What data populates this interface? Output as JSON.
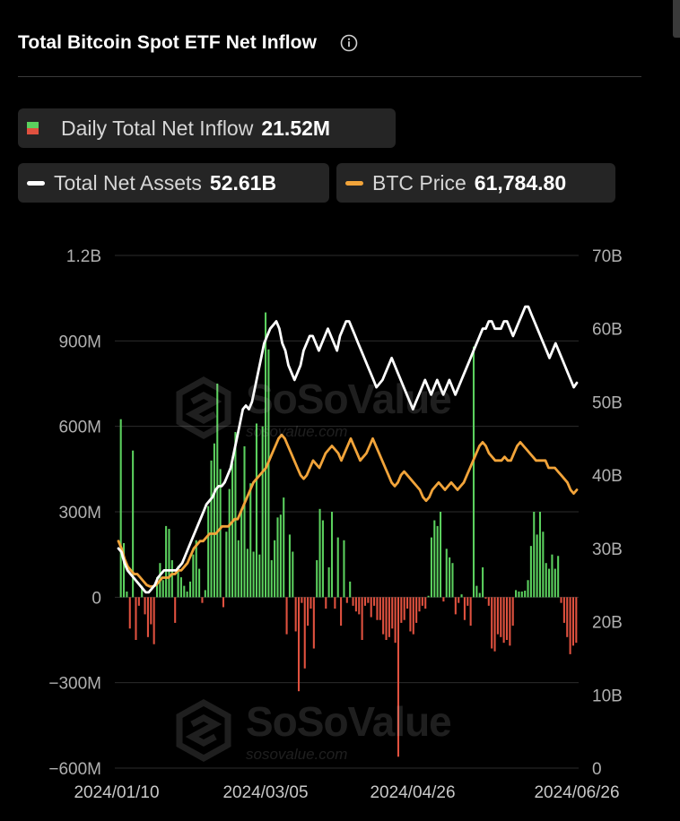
{
  "header": {
    "title": "Total Bitcoin Spot ETF Net Inflow",
    "info_icon": "info-circle-icon"
  },
  "legend": {
    "daily": {
      "label": "Daily Total Net Inflow",
      "value": "21.52M",
      "colors": [
        "#5bd05e",
        "#e0513f"
      ]
    },
    "assets": {
      "label": "Total Net Assets",
      "value": "52.61B",
      "color": "#ffffff"
    },
    "btc": {
      "label": "BTC Price",
      "value": "61,784.80",
      "color": "#f2a43a"
    }
  },
  "watermark": {
    "brand": "SoSoValue",
    "site": "sosovalue.com",
    "logo_icon": "sosovalue-logo-icon"
  },
  "chart_data": {
    "type": "bar",
    "left_axis": {
      "ticks": [
        "1.2B",
        "900M",
        "600M",
        "300M",
        "0",
        "−300M",
        "−600M"
      ],
      "values": [
        1200,
        900,
        600,
        300,
        0,
        -300,
        -600
      ],
      "unit": "M",
      "range": [
        -600,
        1200
      ]
    },
    "right_axis": {
      "ticks": [
        "70B",
        "60B",
        "50B",
        "40B",
        "30B",
        "20B",
        "10B",
        "0"
      ],
      "values": [
        70,
        60,
        50,
        40,
        30,
        20,
        10,
        0
      ],
      "unit": "B",
      "range": [
        0,
        70
      ]
    },
    "x_ticks": [
      "2024/01/10",
      "2024/03/05",
      "2024/04/26",
      "2024/06/26"
    ],
    "grid": "horizontal",
    "colors": {
      "positive": "#5bd05e",
      "negative": "#e0513f",
      "assets": "#ffffff",
      "btc": "#f2a43a"
    },
    "series": [
      {
        "name": "Daily Total Net Inflow",
        "axis": "left",
        "kind": "bar",
        "values": [
          625,
          190,
          20,
          -110,
          515,
          -150,
          -30,
          40,
          -60,
          -140,
          -95,
          -165,
          70,
          120,
          60,
          250,
          240,
          130,
          -90,
          110,
          70,
          40,
          20,
          55,
          150,
          200,
          100,
          -20,
          25,
          320,
          480,
          540,
          750,
          450,
          -35,
          230,
          380,
          470,
          580,
          200,
          310,
          530,
          170,
          400,
          160,
          610,
          150,
          600,
          1000,
          870,
          130,
          200,
          280,
          290,
          350,
          -130,
          220,
          160,
          -120,
          -330,
          -20,
          -250,
          -100,
          -40,
          -180,
          130,
          310,
          270,
          -40,
          105,
          300,
          -40,
          210,
          -100,
          200,
          -20,
          55,
          -30,
          -50,
          -60,
          -150,
          -30,
          -20,
          -70,
          -30,
          -80,
          -80,
          -130,
          -150,
          -140,
          -110,
          -160,
          -560,
          -90,
          -80,
          -40,
          -120,
          -130,
          -90,
          -50,
          -30,
          -40,
          5,
          210,
          270,
          250,
          300,
          -15,
          170,
          140,
          120,
          -60,
          -20,
          10,
          -80,
          -30,
          -100,
          880,
          40,
          15,
          105,
          -5,
          -30,
          -180,
          -190,
          -130,
          -140,
          -160,
          -150,
          -170,
          -100,
          25,
          20,
          20,
          23,
          60,
          180,
          300,
          220,
          300,
          230,
          120,
          100,
          150,
          100,
          145,
          -20,
          -90,
          -140,
          -200,
          -170,
          -160
        ]
      },
      {
        "name": "Total Net Assets",
        "axis": "right",
        "kind": "line",
        "values": [
          30,
          29.5,
          28,
          27,
          26.5,
          26,
          25.5,
          25,
          24.5,
          24,
          24,
          24.5,
          25,
          26,
          26.5,
          27,
          27,
          27,
          27,
          27,
          27.5,
          28,
          29,
          30,
          31,
          32,
          33,
          34,
          35,
          36,
          36.5,
          37,
          38,
          38.5,
          38.5,
          39,
          40,
          41,
          43,
          45,
          47,
          49,
          49.5,
          49,
          50,
          52,
          54,
          56,
          58,
          59,
          60,
          60.5,
          61,
          60,
          58,
          57,
          55,
          54,
          53,
          54,
          55,
          57,
          58,
          59,
          59,
          58,
          57,
          58,
          59,
          60,
          59,
          58,
          57,
          59,
          60,
          61,
          61,
          60,
          59,
          58,
          57,
          56,
          55,
          54,
          53,
          52,
          52.5,
          53,
          54,
          55,
          56,
          55,
          54,
          53,
          52,
          51,
          50,
          49,
          50,
          51,
          52,
          53,
          52,
          51,
          52,
          53,
          52,
          51,
          52,
          53,
          52,
          51,
          52,
          53,
          54,
          55,
          56,
          57,
          58,
          59,
          60,
          60,
          61,
          61,
          60,
          60,
          60,
          61,
          61,
          60,
          59,
          60,
          61,
          62,
          63,
          63,
          62,
          61,
          60,
          59,
          58,
          57,
          56,
          57,
          58,
          57,
          56,
          55,
          54,
          53,
          52,
          52.61
        ]
      },
      {
        "name": "BTC Price",
        "axis": "right",
        "kind": "line",
        "values": [
          31,
          30,
          28.5,
          27.5,
          27,
          26.5,
          26.5,
          26,
          25.5,
          25,
          24.8,
          24.8,
          25,
          25.5,
          26,
          26,
          26,
          26.5,
          26.5,
          27,
          27,
          27.5,
          28,
          29,
          30,
          30.5,
          31,
          31,
          31.5,
          32,
          32,
          32,
          32.5,
          33,
          33,
          33,
          33.5,
          34,
          34,
          35,
          36,
          37,
          38,
          39,
          39.5,
          40,
          40.5,
          41,
          42,
          43,
          44,
          45,
          45.5,
          45,
          44,
          43,
          42,
          41,
          40,
          39.5,
          40,
          41,
          42,
          41.5,
          41,
          42,
          43,
          43.5,
          44,
          43.5,
          43,
          42,
          43,
          44,
          45,
          44,
          43,
          42,
          42.5,
          43,
          44,
          45,
          44,
          43,
          42,
          41,
          40,
          39,
          38.5,
          39,
          40,
          40.5,
          40,
          39.5,
          39,
          38.5,
          38,
          37,
          36.5,
          37,
          38,
          38.5,
          39,
          38.5,
          38,
          38.5,
          39,
          38.5,
          38,
          38.5,
          39,
          40,
          41,
          42,
          43,
          44,
          44.5,
          44,
          43,
          42.5,
          42,
          42,
          42,
          42.5,
          42,
          42,
          43,
          44,
          44.5,
          44,
          43.5,
          43,
          42.5,
          42,
          42,
          42,
          42,
          41,
          41,
          41,
          40.5,
          40,
          39.5,
          39,
          38,
          37.5,
          38
        ]
      }
    ]
  }
}
